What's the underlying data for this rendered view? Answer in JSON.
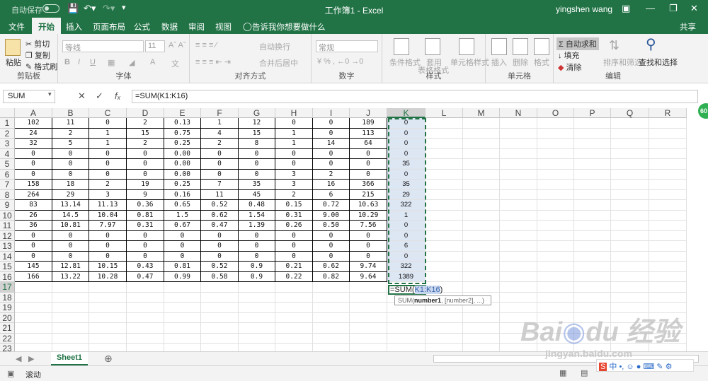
{
  "titlebar": {
    "autosave": "自动保存",
    "toggle": "关",
    "title": "工作簿1 - Excel",
    "user": "yingshen wang"
  },
  "tabs": [
    "文件",
    "开始",
    "插入",
    "页面布局",
    "公式",
    "数据",
    "审阅",
    "视图"
  ],
  "tell_me": "告诉我你想要做什么",
  "share": "共享",
  "ribbon": {
    "clipboard": {
      "paste": "粘贴",
      "cut": "剪切",
      "copy": "复制",
      "format_painter": "格式刷",
      "label": "剪贴板"
    },
    "font": {
      "name_placeholder": "等线",
      "size": "11",
      "label": "字体"
    },
    "align": {
      "wrap": "自动换行",
      "merge": "合并后居中",
      "label": "对齐方式"
    },
    "number": {
      "format": "常规",
      "label": "数字"
    },
    "styles": {
      "conditional": "条件格式",
      "table1": "套用",
      "table2": "表格格式",
      "cell_styles": "单元格样式",
      "label": "样式"
    },
    "cells": {
      "insert": "插入",
      "delete": "删除",
      "format": "格式",
      "label": "单元格"
    },
    "editing": {
      "autosum": "自动求和",
      "fill": "填充",
      "clear": "清除",
      "sort": "排序和筛选",
      "find": "查找和选择",
      "label": "编辑"
    }
  },
  "formula_bar": {
    "name_box": "SUM",
    "formula": "=SUM(K1:K16)"
  },
  "columns": [
    "A",
    "B",
    "C",
    "D",
    "E",
    "F",
    "G",
    "H",
    "I",
    "J",
    "K",
    "L",
    "M",
    "N",
    "O",
    "P",
    "Q",
    "R"
  ],
  "rows": [
    "1",
    "2",
    "3",
    "4",
    "5",
    "6",
    "7",
    "8",
    "9",
    "10",
    "11",
    "12",
    "13",
    "14",
    "15",
    "16",
    "17",
    "18",
    "19",
    "20",
    "21",
    "22",
    "23"
  ],
  "table": [
    [
      "102",
      "11",
      "0",
      "2",
      "0.13",
      "1",
      "12",
      "0",
      "0",
      "189",
      "0"
    ],
    [
      "24",
      "2",
      "1",
      "15",
      "0.75",
      "4",
      "15",
      "1",
      "0",
      "113",
      "0"
    ],
    [
      "32",
      "5",
      "1",
      "2",
      "0.25",
      "2",
      "8",
      "1",
      "14",
      "64",
      "0"
    ],
    [
      "0",
      "0",
      "0",
      "0",
      "0.00",
      "0",
      "0",
      "0",
      "0",
      "0",
      "0"
    ],
    [
      "0",
      "0",
      "0",
      "0",
      "0.00",
      "0",
      "0",
      "0",
      "0",
      "0",
      "35"
    ],
    [
      "0",
      "0",
      "0",
      "0",
      "0.00",
      "0",
      "0",
      "3",
      "2",
      "0",
      "0"
    ],
    [
      "158",
      "18",
      "2",
      "19",
      "0.25",
      "7",
      "35",
      "3",
      "16",
      "366",
      "35"
    ],
    [
      "264",
      "29",
      "3",
      "9",
      "0.16",
      "11",
      "45",
      "2",
      "6",
      "215",
      "29"
    ],
    [
      "83",
      "13.14",
      "11.13",
      "0.36",
      "0.65",
      "0.52",
      "0.48",
      "0.15",
      "0.72",
      "10.63",
      "322"
    ],
    [
      "26",
      "14.5",
      "10.04",
      "0.81",
      "1.5",
      "0.62",
      "1.54",
      "0.31",
      "9.00",
      "10.29",
      "1"
    ],
    [
      "36",
      "10.81",
      "7.97",
      "0.31",
      "0.67",
      "0.47",
      "1.39",
      "0.26",
      "0.50",
      "7.56",
      "0"
    ],
    [
      "0",
      "0",
      "0",
      "0",
      "0",
      "0",
      "0",
      "0",
      "0",
      "0",
      "0"
    ],
    [
      "0",
      "0",
      "0",
      "0",
      "0",
      "0",
      "0",
      "0",
      "0",
      "0",
      "6"
    ],
    [
      "0",
      "0",
      "0",
      "0",
      "0",
      "0",
      "0",
      "0",
      "0",
      "0",
      "0"
    ],
    [
      "145",
      "12.81",
      "10.15",
      "0.43",
      "0.81",
      "0.52",
      "0.9",
      "0.21",
      "0.62",
      "9.74",
      "322"
    ],
    [
      "166",
      "13.22",
      "10.28",
      "0.47",
      "0.99",
      "0.58",
      "0.9",
      "0.22",
      "0.82",
      "9.64",
      "1389"
    ]
  ],
  "edit_cell": {
    "prefix": "=SUM(",
    "ref": "K1:K16",
    "suffix": ")"
  },
  "tooltip": {
    "fn": "SUM(",
    "arg1": "number1",
    "rest": ", [number2], ...)"
  },
  "sheet_tab": "Sheet1",
  "status": {
    "mode": "滚动"
  },
  "badge": "60",
  "watermark": {
    "logo": "Bai",
    "logo2": "经验",
    "url": "jingyan.baidu.com"
  }
}
